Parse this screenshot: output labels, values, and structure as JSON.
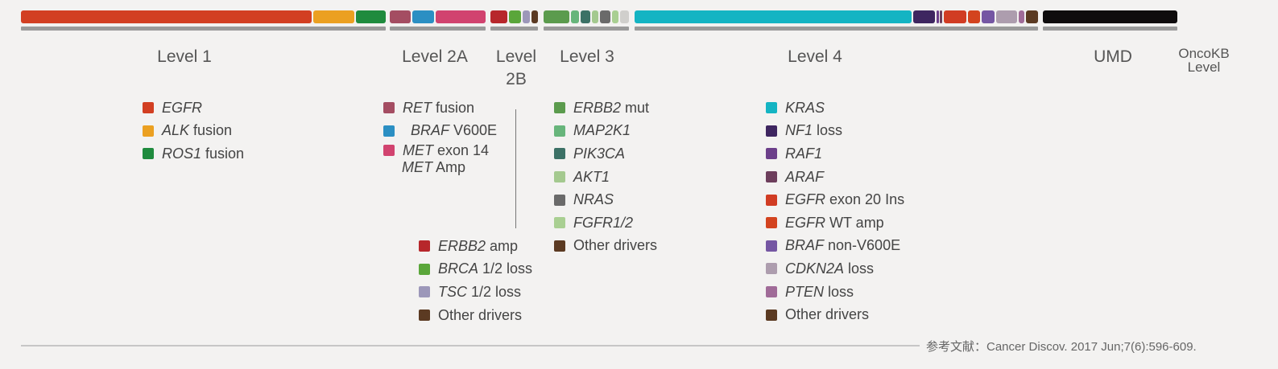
{
  "colors": {
    "egfr": "#d23f22",
    "alk": "#eba021",
    "ros1": "#1f8b3e",
    "ret": "#a44d62",
    "braf_v600e": "#2b8fc3",
    "met": "#d1436f",
    "erbb2_amp": "#b7272b",
    "brca": "#5aa63a",
    "tsc": "#9c97b9",
    "other_brown": "#5b3a22",
    "erbb2_mut": "#5b9b4d",
    "map2k1": "#67b57b",
    "pik3ca": "#3c7166",
    "akt1": "#a4c98f",
    "nras": "#6a6a6a",
    "fgfr": "#a9cf92",
    "kras": "#14b4c3",
    "nf1": "#3e2660",
    "raf1": "#6c3f8a",
    "araf": "#6d3e5c",
    "egfr_ex20": "#d13c23",
    "egfr_wt": "#d3431f",
    "braf_non": "#7556a3",
    "cdkn2a": "#ad9dae",
    "pten": "#a06b98",
    "umd": "#0f0c0d",
    "bracket": "#9a9a9a"
  },
  "levels": {
    "level1": "Level 1",
    "level2a": "Level 2A",
    "level2b_line1": "Level",
    "level2b_line2": "2B",
    "level3": "Level 3",
    "level4": "Level 4",
    "umd": "UMD",
    "oncokb_line1": "OncoKB",
    "oncokb_line2": "Level"
  },
  "legend": {
    "level1": [
      {
        "gene": "EGFR",
        "suffix": ""
      },
      {
        "gene": "ALK",
        "suffix": " fusion"
      },
      {
        "gene": "ROS1",
        "suffix": " fusion"
      }
    ],
    "level2a": [
      {
        "gene": "RET",
        "suffix": " fusion"
      },
      {
        "gene": "BRAF",
        "suffix": " V600E"
      },
      {
        "gene": "MET",
        "suffix": " exon 14"
      },
      {
        "gene": "MET",
        "suffix": " Amp"
      }
    ],
    "level2b": [
      {
        "gene": "ERBB2",
        "suffix": " amp"
      },
      {
        "gene": "BRCA",
        "suffix": " 1/2 loss"
      },
      {
        "gene": "TSC",
        "suffix": " 1/2 loss"
      },
      {
        "gene": "",
        "suffix": "Other drivers"
      }
    ],
    "level3": [
      {
        "gene": "ERBB2",
        "suffix": " mut"
      },
      {
        "gene": "MAP2K1",
        "suffix": ""
      },
      {
        "gene": "PIK3CA",
        "suffix": ""
      },
      {
        "gene": "AKT1",
        "suffix": ""
      },
      {
        "gene": "NRAS",
        "suffix": ""
      },
      {
        "gene": "FGFR1/2",
        "suffix": ""
      },
      {
        "gene": "",
        "suffix": "Other drivers"
      }
    ],
    "level4": [
      {
        "gene": "KRAS",
        "suffix": ""
      },
      {
        "gene": "NF1",
        "suffix": " loss"
      },
      {
        "gene": "RAF1",
        "suffix": ""
      },
      {
        "gene": "ARAF",
        "suffix": ""
      },
      {
        "gene": "EGFR",
        "suffix": " exon 20 Ins"
      },
      {
        "gene": "EGFR",
        "suffix": " WT amp"
      },
      {
        "gene": "BRAF",
        "suffix": " non-V600E"
      },
      {
        "gene": "CDKN2A",
        "suffix": " loss"
      },
      {
        "gene": "PTEN",
        "suffix": " loss"
      },
      {
        "gene": "",
        "suffix": "Other drivers"
      }
    ]
  },
  "reference": "参考文献：Cancer Discov. 2017 Jun;7(6):596-609."
}
